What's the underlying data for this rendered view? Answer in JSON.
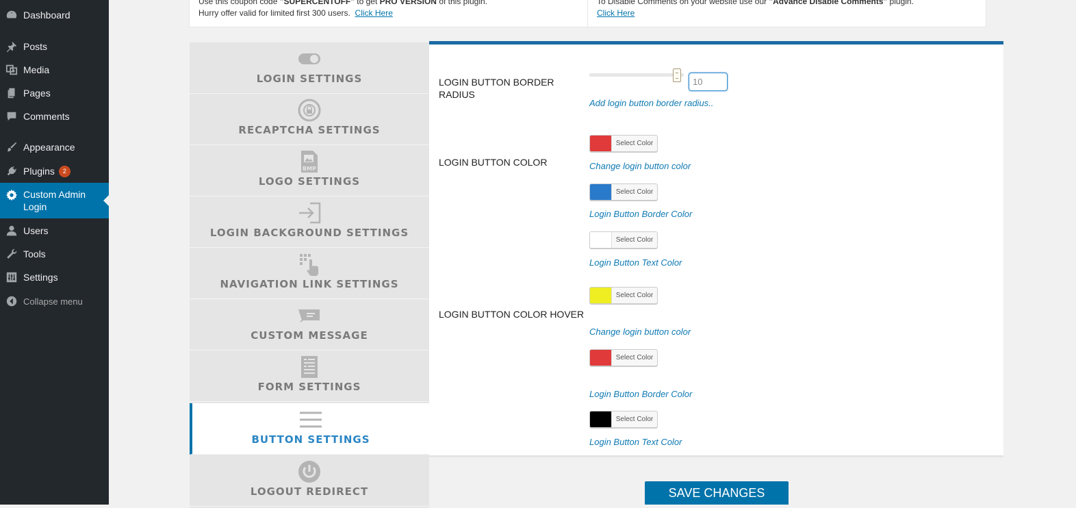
{
  "sidebar": {
    "items": [
      {
        "label": "Dashboard",
        "icon": "dashboard-icon"
      },
      {
        "label": "Posts",
        "icon": "pin-icon"
      },
      {
        "label": "Media",
        "icon": "media-icon"
      },
      {
        "label": "Pages",
        "icon": "pages-icon"
      },
      {
        "label": "Comments",
        "icon": "comment-icon"
      },
      {
        "label": "Appearance",
        "icon": "brush-icon"
      },
      {
        "label": "Plugins",
        "icon": "plugin-icon",
        "badge": "2"
      },
      {
        "label": "Custom Admin Login",
        "icon": "gear-icon",
        "current": true
      },
      {
        "label": "Users",
        "icon": "user-icon"
      },
      {
        "label": "Tools",
        "icon": "wrench-icon"
      },
      {
        "label": "Settings",
        "icon": "settings-icon"
      },
      {
        "label": "Collapse menu",
        "icon": "collapse-icon"
      }
    ]
  },
  "notices": {
    "left": {
      "line1_a": "Use this coupon code ",
      "coupon": "\"SUPERCENTOFF\"",
      "line1_b": " to get ",
      "pro": "PRO VERSION",
      "line1_c": " of this plugin.",
      "line2": "Hurry offer valid for limited first 300 users.",
      "link": "Click Here"
    },
    "right": {
      "line1_a": "To Disable Comments on your website use our ",
      "plugin": "\"Advance Disable Comments\"",
      "line1_b": " plugin.",
      "link": "Click Here"
    }
  },
  "tabs": [
    {
      "label": "LOGIN SETTINGS",
      "icon": "toggle-icon"
    },
    {
      "label": "RECAPTCHA SETTINGS",
      "icon": "recaptcha-lock-icon"
    },
    {
      "label": "LOGO SETTINGS",
      "icon": "bmp-image-icon"
    },
    {
      "label": "LOGIN BACKGROUND SETTINGS",
      "icon": "sign-in-icon"
    },
    {
      "label": "NAVIGATION LINK SETTINGS",
      "icon": "pointer-hand-icon"
    },
    {
      "label": "CUSTOM MESSAGE",
      "icon": "message-icon"
    },
    {
      "label": "FORM SETTINGS",
      "icon": "form-icon"
    },
    {
      "label": "BUTTON SETTINGS",
      "icon": "menu-lines-icon",
      "active": true
    },
    {
      "label": "LOGOUT REDIRECT",
      "icon": "power-icon"
    }
  ],
  "panel": {
    "border_radius": {
      "label": "LOGIN BUTTON BORDER RADIUS",
      "value": "10",
      "slider_fraction": 0.93,
      "hint": "Add login button border radius.."
    },
    "button_color": {
      "label": "LOGIN BUTTON COLOR",
      "pickers": [
        {
          "color": "#e03a3a",
          "button_text": "Select Color",
          "hint": "Change login button color"
        },
        {
          "color": "#2a7acb",
          "button_text": "Select Color",
          "hint": "Login Button Border Color"
        },
        {
          "color": "#ffffff",
          "button_text": "Select Color",
          "hint": "Login Button Text Color"
        }
      ]
    },
    "button_color_hover": {
      "label": "LOGIN BUTTON COLOR HOVER",
      "pickers": [
        {
          "color": "#eeee22",
          "button_text": "Select Color",
          "hint": "Change login button color"
        },
        {
          "color": "#e03a3a",
          "button_text": "Select Color",
          "hint": "Login Button Border Color"
        },
        {
          "color": "#000000",
          "button_text": "Select Color",
          "hint": "Login Button Text Color"
        }
      ]
    }
  },
  "save_label": "SAVE CHANGES",
  "colors": {
    "accent": "#0073aa",
    "sidebar_bg": "#23282d",
    "panel_top_border": "#1c6aa3"
  }
}
